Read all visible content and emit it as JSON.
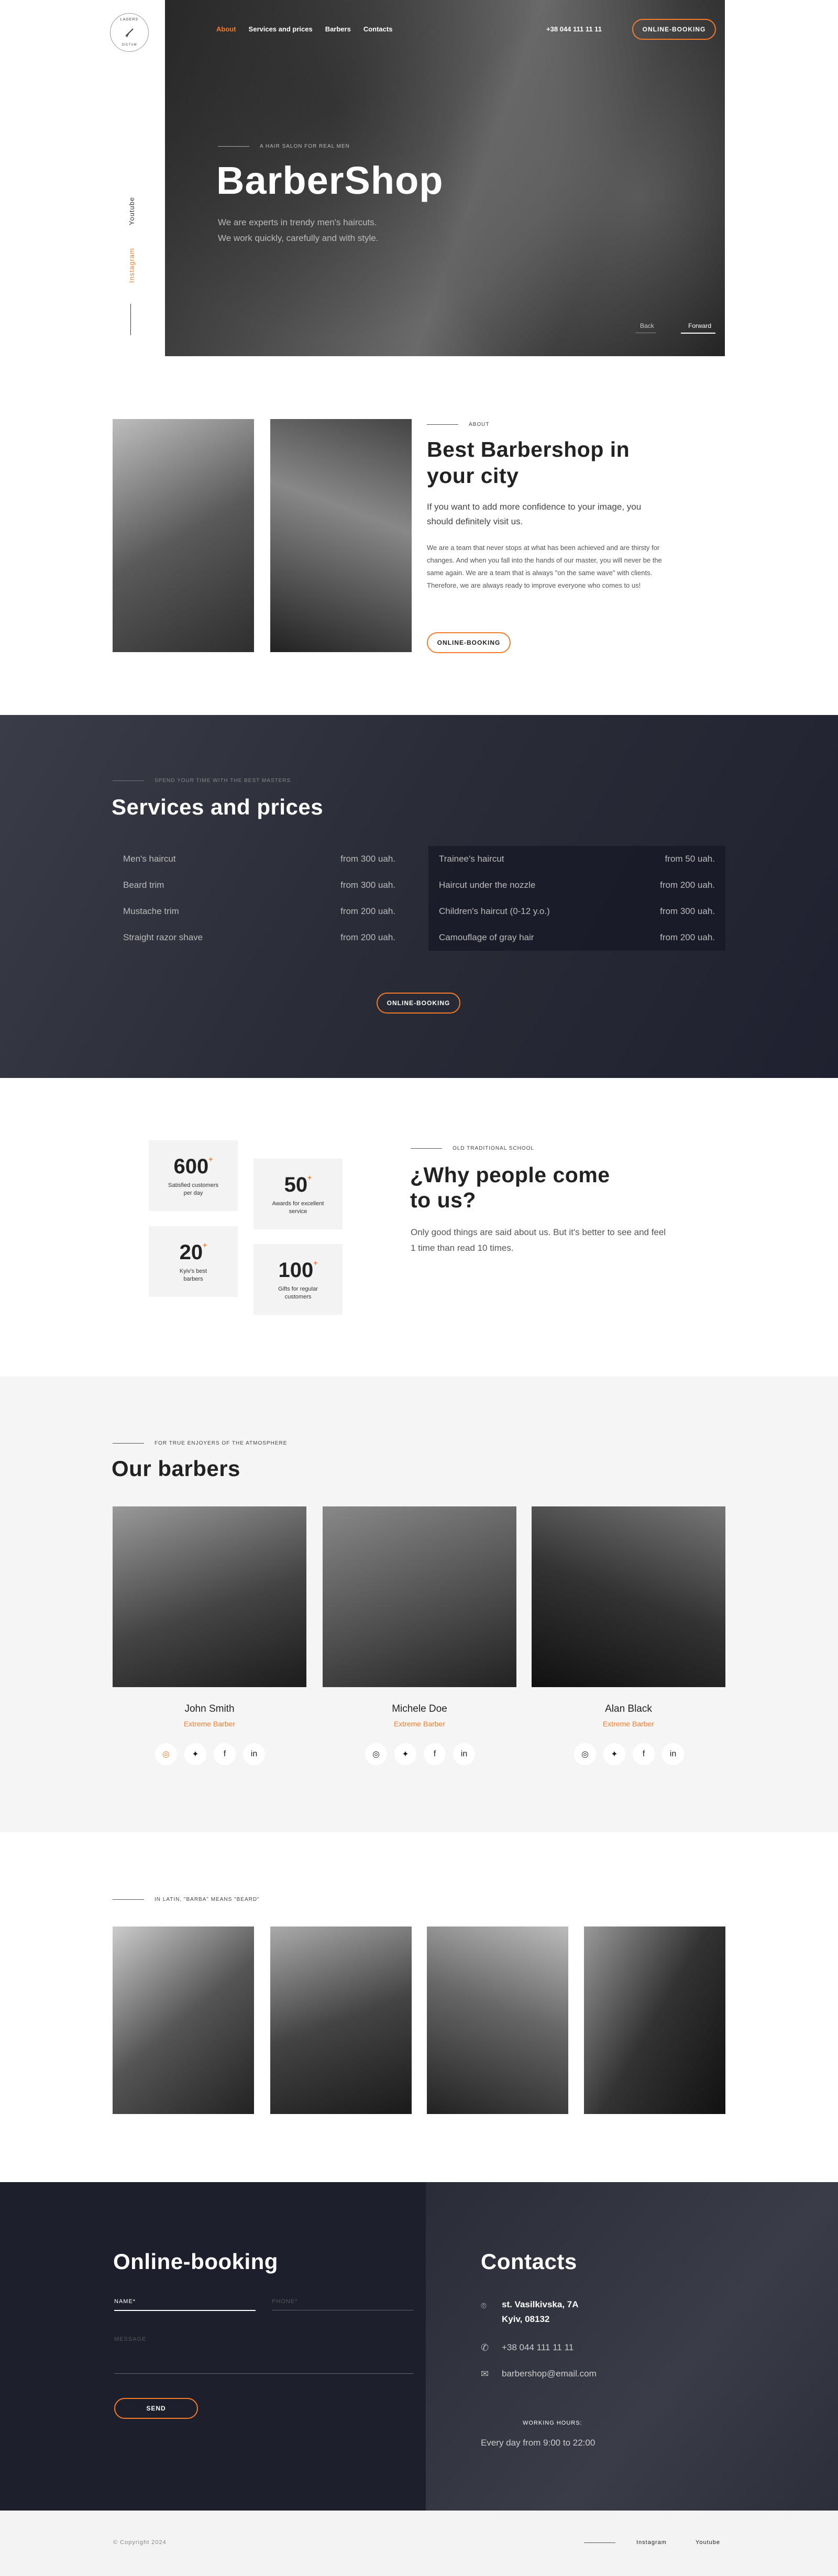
{
  "header": {
    "logo": {
      "top": "LAGERS",
      "bottom": "DICTUM",
      "mid": "Y"
    },
    "social_youtube": "Youtube",
    "social_instagram": "Instagram",
    "nav": [
      "About",
      "Services and prices",
      "Barbers",
      "Contacts"
    ],
    "phone": "+38 044 111 11 11",
    "booking_button": "ONLINE-BOOKING"
  },
  "hero": {
    "kicker": "A HAIR SALON FOR REAL MEN",
    "title": "BarberShop",
    "desc1": "We are experts in trendy men's haircuts.",
    "desc2": "We work quickly, carefully and with style.",
    "back": "Back",
    "forward": "Forward"
  },
  "about": {
    "kicker": "ABOUT",
    "title1": "Best Barbershop in",
    "title2": "your city",
    "lead": "If you want to add more confidence to your image, you should definitely visit us.",
    "body": "We are a team that never stops at what has been achieved and are thirsty for changes. And when you fall into the hands of our master, you will never be the same again. We are a team that is always \"on the same wave\" with clients. Therefore, we are always ready to improve everyone who comes to us!",
    "button": "ONLINE-BOOKING"
  },
  "services": {
    "kicker": "SPEND YOUR TIME WITH THE BEST MASTERS",
    "title": "Services and prices",
    "left": [
      {
        "name": "Men's haircut",
        "price": "from 300 uah."
      },
      {
        "name": "Beard trim",
        "price": "from 300 uah."
      },
      {
        "name": "Mustache trim",
        "price": "from 200 uah."
      },
      {
        "name": "Straight razor shave",
        "price": "from 200 uah."
      }
    ],
    "right": [
      {
        "name": "Trainee's haircut",
        "price": "from 50 uah."
      },
      {
        "name": "Haircut under the nozzle",
        "price": "from 200 uah."
      },
      {
        "name": "Children's haircut (0-12 y.o.)",
        "price": "from 300 uah."
      },
      {
        "name": "Camouflage of gray hair",
        "price": "from 200 uah."
      }
    ],
    "button": "ONLINE-BOOKING"
  },
  "why": {
    "stats": [
      {
        "num": "600",
        "plus": "+",
        "label1": "Satisfied customers",
        "label2": "per day"
      },
      {
        "num": "50",
        "plus": "+",
        "label1": "Awards for excellent",
        "label2": "service"
      },
      {
        "num": "20",
        "plus": "+",
        "label1": "Kyiv's best",
        "label2": "barbers"
      },
      {
        "num": "100",
        "plus": "+",
        "label1": "Gifts for regular",
        "label2": "customers"
      }
    ],
    "kicker": "OLD TRADITIONAL SCHOOL",
    "title1": "¿Why people come",
    "title2": "to us?",
    "desc": "Only good things are said about us. But it's better to see and feel 1 time than read 10 times."
  },
  "barbers": {
    "kicker": "FOR TRUE ENJOYERS OF THE ATMOSPHERE",
    "title": "Our barbers",
    "list": [
      {
        "name": "John Smith",
        "role": "Extreme Barber"
      },
      {
        "name": "Michele Doe",
        "role": "Extreme Barber"
      },
      {
        "name": "Alan Black",
        "role": "Extreme Barber"
      }
    ]
  },
  "gallery": {
    "kicker": "IN LATIN, \"BARBA\" MEANS \"BEARD\""
  },
  "booking": {
    "title": "Online-booking",
    "name_label": "NAME*",
    "phone_label": "PHONE*",
    "message_label": "MESSAGE",
    "send": "SEND"
  },
  "contacts": {
    "title": "Contacts",
    "address1": "st. Vasilkivska, 7A",
    "address2": "Kyiv, 08132",
    "phone": "+38 044 111 11 11",
    "email": "barbershop@email.com",
    "hours_label": "WORKING HOURS:",
    "hours": "Every day from 9:00 to 22:00"
  },
  "footer": {
    "copyright": "© Copyright 2024",
    "instagram": "Instagram",
    "youtube": "Youtube"
  },
  "colors": {
    "accent": "#f47b2a",
    "dark": "#1d1f2c"
  }
}
